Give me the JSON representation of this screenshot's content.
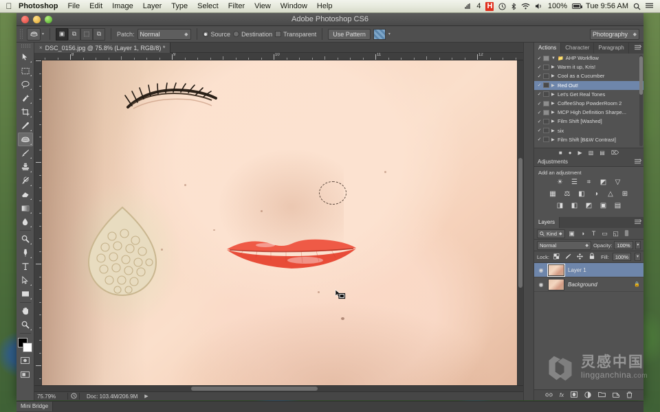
{
  "menubar": {
    "apple_icon": "apple-logo",
    "items": [
      {
        "label": "Photoshop",
        "bold": true
      },
      {
        "label": "File",
        "bold": false
      },
      {
        "label": "Edit",
        "bold": false
      },
      {
        "label": "Image",
        "bold": false
      },
      {
        "label": "Layer",
        "bold": false
      },
      {
        "label": "Type",
        "bold": false
      },
      {
        "label": "Select",
        "bold": false
      },
      {
        "label": "Filter",
        "bold": false
      },
      {
        "label": "View",
        "bold": false
      },
      {
        "label": "Window",
        "bold": false
      },
      {
        "label": "Help",
        "bold": false
      }
    ],
    "status": {
      "signal_icon": "signal-bars-icon",
      "signal_count": "4",
      "alert_badge": "H",
      "clock_icon": "time-machine-icon",
      "bluetooth_icon": "bluetooth-icon",
      "wifi_icon": "wifi-icon",
      "volume_icon": "volume-icon",
      "battery_percent": "100%",
      "battery_icon": "battery-icon",
      "datetime": "Tue 9:56 AM",
      "search_icon": "spotlight-search-icon",
      "notifications_icon": "notification-center-icon"
    }
  },
  "window": {
    "title": "Adobe Photoshop CS6",
    "close_label": "close",
    "minimize_label": "minimize",
    "zoom_label": "zoom"
  },
  "options_bar": {
    "tool_preset_icon": "patch-tool-icon",
    "selection_modes": [
      {
        "name": "new-selection",
        "glyph": "▣",
        "active": true
      },
      {
        "name": "add-to-selection",
        "glyph": "⧉",
        "active": false
      },
      {
        "name": "subtract-from-selection",
        "glyph": "⬚",
        "active": false
      },
      {
        "name": "intersect-selection",
        "glyph": "⧉",
        "active": false
      }
    ],
    "patch_label": "Patch:",
    "patch_value": "Normal",
    "source_label": "Source",
    "source_selected": true,
    "destination_label": "Destination",
    "destination_selected": false,
    "transparent_label": "Transparent",
    "transparent_checked": false,
    "use_pattern_label": "Use Pattern",
    "pattern_swatch": "pattern-swatch",
    "workspace_value": "Photography"
  },
  "toolbar": {
    "tools": [
      {
        "name": "move-tool",
        "glyph": "↖",
        "active": false
      },
      {
        "name": "rectangular-marquee-tool",
        "glyph": "⬚",
        "active": false
      },
      {
        "name": "lasso-tool",
        "glyph": "❦",
        "active": false
      },
      {
        "name": "quick-selection-tool",
        "glyph": "✦",
        "active": false
      },
      {
        "name": "crop-tool",
        "glyph": "⌗",
        "active": false
      },
      {
        "name": "eyedropper-tool",
        "glyph": "✒",
        "active": false
      },
      {
        "name": "patch-tool",
        "glyph": "⚗",
        "active": true
      },
      {
        "name": "brush-tool",
        "glyph": "╱",
        "active": false
      },
      {
        "name": "clone-stamp-tool",
        "glyph": "⤓",
        "active": false
      },
      {
        "name": "history-brush-tool",
        "glyph": "⤳",
        "active": false
      },
      {
        "name": "eraser-tool",
        "glyph": "◰",
        "active": false
      },
      {
        "name": "gradient-tool",
        "glyph": "▤",
        "active": false
      },
      {
        "name": "blur-tool",
        "glyph": "●",
        "active": false
      },
      {
        "name": "dodge-tool",
        "glyph": "⚲",
        "active": false
      },
      {
        "name": "pen-tool",
        "glyph": "✑",
        "active": false
      },
      {
        "name": "type-tool",
        "glyph": "T",
        "active": false
      },
      {
        "name": "path-selection-tool",
        "glyph": "➤",
        "active": false
      },
      {
        "name": "rectangle-shape-tool",
        "glyph": "▭",
        "active": false
      },
      {
        "name": "hand-tool",
        "glyph": "✋",
        "active": false
      },
      {
        "name": "zoom-tool",
        "glyph": "⚲",
        "active": false
      }
    ],
    "foreground_color": "#000000",
    "background_color": "#ffffff",
    "quick_mask_name": "quick-mask-toggle",
    "screen_mode_name": "screen-mode-toggle"
  },
  "document": {
    "tab_title": "DSC_0156.jpg @ 75.8% (Layer 1, RGB/8) *",
    "close_glyph": "×",
    "ruler_units": "inches",
    "ruler_marks": [
      "8",
      "9",
      "10",
      "11",
      "12"
    ],
    "selection_name": "marching-ants-selection",
    "cursor_name": "patch-tool-cursor"
  },
  "status_bar": {
    "zoom_level": "75.79%",
    "doc_info": "Doc: 103.4M/206.9M",
    "arrow_glyph": "▶"
  },
  "panels": {
    "top_group": {
      "tabs": [
        {
          "label": "Actions",
          "active": true
        },
        {
          "label": "Character",
          "active": false
        },
        {
          "label": "Paragraph",
          "active": false
        }
      ],
      "menu_icon": "panel-menu-icon",
      "actions": [
        {
          "label": "AHP Workflow",
          "selected": false,
          "is_set": true,
          "box": "filled"
        },
        {
          "label": "Warm it up, Kris!",
          "selected": false,
          "is_set": false,
          "box": "empty"
        },
        {
          "label": "Cool as a Cucumber",
          "selected": false,
          "is_set": false,
          "box": "empty"
        },
        {
          "label": "Red Out!",
          "selected": true,
          "is_set": false,
          "box": "empty"
        },
        {
          "label": "Let's Get Real Tones",
          "selected": false,
          "is_set": false,
          "box": "empty"
        },
        {
          "label": "CoffeeShop PowderRoom 2",
          "selected": false,
          "is_set": false,
          "box": "filled"
        },
        {
          "label": "MCP High Definition Sharpe...",
          "selected": false,
          "is_set": false,
          "box": "filled"
        },
        {
          "label": "Film Shift [Washed]",
          "selected": false,
          "is_set": false,
          "box": "empty"
        },
        {
          "label": "six",
          "selected": false,
          "is_set": false,
          "box": "empty"
        },
        {
          "label": "Film Shift [B&W Contrast]",
          "selected": false,
          "is_set": false,
          "box": "empty"
        }
      ],
      "footer_buttons": [
        {
          "name": "stop-playing-button",
          "glyph": "■"
        },
        {
          "name": "begin-recording-button",
          "glyph": "●"
        },
        {
          "name": "play-selection-button",
          "glyph": "▶"
        },
        {
          "name": "create-new-set-button",
          "glyph": "▧"
        },
        {
          "name": "create-new-action-button",
          "glyph": "▤"
        },
        {
          "name": "delete-action-button",
          "glyph": "⌦"
        }
      ]
    },
    "adjustments": {
      "title": "Adjustments",
      "menu_icon": "panel-menu-icon",
      "subtitle": "Add an adjustment",
      "rows": [
        [
          {
            "name": "brightness-contrast-adjustment",
            "glyph": "☀"
          },
          {
            "name": "levels-adjustment",
            "glyph": "☰"
          },
          {
            "name": "curves-adjustment",
            "glyph": "⌗"
          },
          {
            "name": "exposure-adjustment",
            "glyph": "◩"
          },
          {
            "name": "vibrance-adjustment",
            "glyph": "▽"
          }
        ],
        [
          {
            "name": "hue-saturation-adjustment",
            "glyph": "▦"
          },
          {
            "name": "color-balance-adjustment",
            "glyph": "⚖"
          },
          {
            "name": "black-white-adjustment",
            "glyph": "◧"
          },
          {
            "name": "photo-filter-adjustment",
            "glyph": "◑"
          },
          {
            "name": "channel-mixer-adjustment",
            "glyph": "△"
          },
          {
            "name": "color-lookup-adjustment",
            "glyph": "⊞"
          }
        ],
        [
          {
            "name": "invert-adjustment",
            "glyph": "◨"
          },
          {
            "name": "posterize-adjustment",
            "glyph": "◧"
          },
          {
            "name": "threshold-adjustment",
            "glyph": "◩"
          },
          {
            "name": "selective-color-adjustment",
            "glyph": "▣"
          },
          {
            "name": "gradient-map-adjustment",
            "glyph": "▤"
          }
        ]
      ]
    },
    "layers": {
      "title": "Layers",
      "menu_icon": "panel-menu-icon",
      "filter_kind_label": "Kind",
      "filter_icons": [
        {
          "name": "filter-pixel-layers-icon",
          "glyph": "▣"
        },
        {
          "name": "filter-adjustment-layers-icon",
          "glyph": "◑"
        },
        {
          "name": "filter-type-layers-icon",
          "glyph": "T"
        },
        {
          "name": "filter-shape-layers-icon",
          "glyph": "▭"
        },
        {
          "name": "filter-smart-objects-icon",
          "glyph": "◱"
        }
      ],
      "filter_toggle_icon": "filter-enable-toggle-icon",
      "blend_mode": "Normal",
      "opacity_label": "Opacity:",
      "opacity_value": "100%",
      "lock_label": "Lock:",
      "lock_icons": [
        {
          "name": "lock-transparent-pixels-icon",
          "glyph": "░"
        },
        {
          "name": "lock-image-pixels-icon",
          "glyph": "╱"
        },
        {
          "name": "lock-position-icon",
          "glyph": "✥"
        },
        {
          "name": "lock-all-icon",
          "glyph": "ὑ2"
        }
      ],
      "fill_label": "Fill:",
      "fill_value": "100%",
      "rows": [
        {
          "name": "Layer 1",
          "selected": true,
          "locked": false,
          "italic": false
        },
        {
          "name": "Background",
          "selected": false,
          "locked": true,
          "italic": true
        }
      ],
      "footer_buttons": [
        {
          "name": "link-layers-button",
          "glyph": "⚭"
        },
        {
          "name": "layer-style-button",
          "glyph": "ƒх"
        },
        {
          "name": "add-layer-mask-button",
          "glyph": "▣"
        },
        {
          "name": "new-adjustment-layer-button",
          "glyph": "◑"
        },
        {
          "name": "new-group-button",
          "glyph": "▱"
        },
        {
          "name": "new-layer-button",
          "glyph": "◰"
        },
        {
          "name": "delete-layer-button",
          "glyph": "⌦"
        }
      ]
    }
  },
  "mini_bridge": {
    "tab_label": "Mini Bridge"
  },
  "watermark": {
    "chinese": "灵感中国",
    "domain": "lingganchina",
    "tld": ".com",
    "logo_name": "lingganchina-logo"
  },
  "colors": {
    "selection_blue": "#6e86ab",
    "panel_bg": "#525252",
    "chrome_bg": "#4c4c4c",
    "menubar_bg": "#e6e9dc"
  }
}
